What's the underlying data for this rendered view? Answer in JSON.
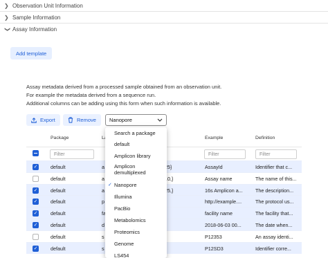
{
  "accordion": [
    {
      "label": "Observation Unit Information",
      "expanded": false
    },
    {
      "label": "Sample Information",
      "expanded": false
    },
    {
      "label": "Assay Information",
      "expanded": true
    }
  ],
  "add_template_label": "Add template",
  "description": [
    "Assay metadata derived from a processed sample obtained from an observation unit.",
    "For example the metadata derived from a sequence run.",
    "Additional columns can be adding using this form when such information is available."
  ],
  "toolbar": {
    "export_label": "Export",
    "remove_label": "Remove",
    "select_value": "Nanopore"
  },
  "table": {
    "headers": [
      "Package",
      "La",
      "",
      "Example",
      "Definition"
    ],
    "filter_placeholder": "Filter",
    "rows": [
      {
        "selected": true,
        "package": "default",
        "label": "a",
        "value": "25}",
        "example": "AssayId",
        "definition": "Identifier that c..."
      },
      {
        "selected": false,
        "package": "default",
        "label": "a",
        "value": "10,}",
        "example": "Assay name",
        "definition": "The name of this..."
      },
      {
        "selected": true,
        "package": "default",
        "label": "a",
        "value": "25,}",
        "example": "16s Amplicon a...",
        "definition": "The description..."
      },
      {
        "selected": true,
        "package": "default",
        "label": "p",
        "value": "",
        "example": "http://example....",
        "definition": "The protocol us..."
      },
      {
        "selected": true,
        "package": "default",
        "label": "fa",
        "value": "",
        "example": "facility name",
        "definition": "The facility that..."
      },
      {
        "selected": true,
        "package": "default",
        "label": "d",
        "value": "",
        "example": "2018-06-03 00...",
        "definition": "The date when..."
      },
      {
        "selected": false,
        "package": "default",
        "label": "s",
        "value": "",
        "example": "P12353",
        "definition": "An assay identi..."
      },
      {
        "selected": true,
        "package": "default",
        "label": "s",
        "value": "",
        "example": "P12SD3",
        "definition": "Identifier corre..."
      }
    ]
  },
  "dropdown": {
    "items": [
      {
        "label": "Search a package",
        "checked": false
      },
      {
        "label": "default",
        "checked": false
      },
      {
        "label": "Amplicon library",
        "checked": false
      },
      {
        "label": "Amplicon demultiplexed",
        "checked": false
      },
      {
        "label": "Nanopore",
        "checked": true
      },
      {
        "label": "Illumina",
        "checked": false
      },
      {
        "label": "PacBio",
        "checked": false
      },
      {
        "label": "Metabolomics",
        "checked": false
      },
      {
        "label": "Proteomics",
        "checked": false
      },
      {
        "label": "Genome",
        "checked": false
      },
      {
        "label": "LS454",
        "checked": false
      }
    ]
  },
  "colors": {
    "accent": "#1f5fd6",
    "selected_row": "#e8efff",
    "button_bg": "#e6efff"
  },
  "icons": {
    "collapsed": "chevron-right-icon",
    "expanded": "chevron-down-icon",
    "export": "export-icon",
    "remove": "trash-icon",
    "select": "chevron-down-icon",
    "check": "check-icon"
  }
}
